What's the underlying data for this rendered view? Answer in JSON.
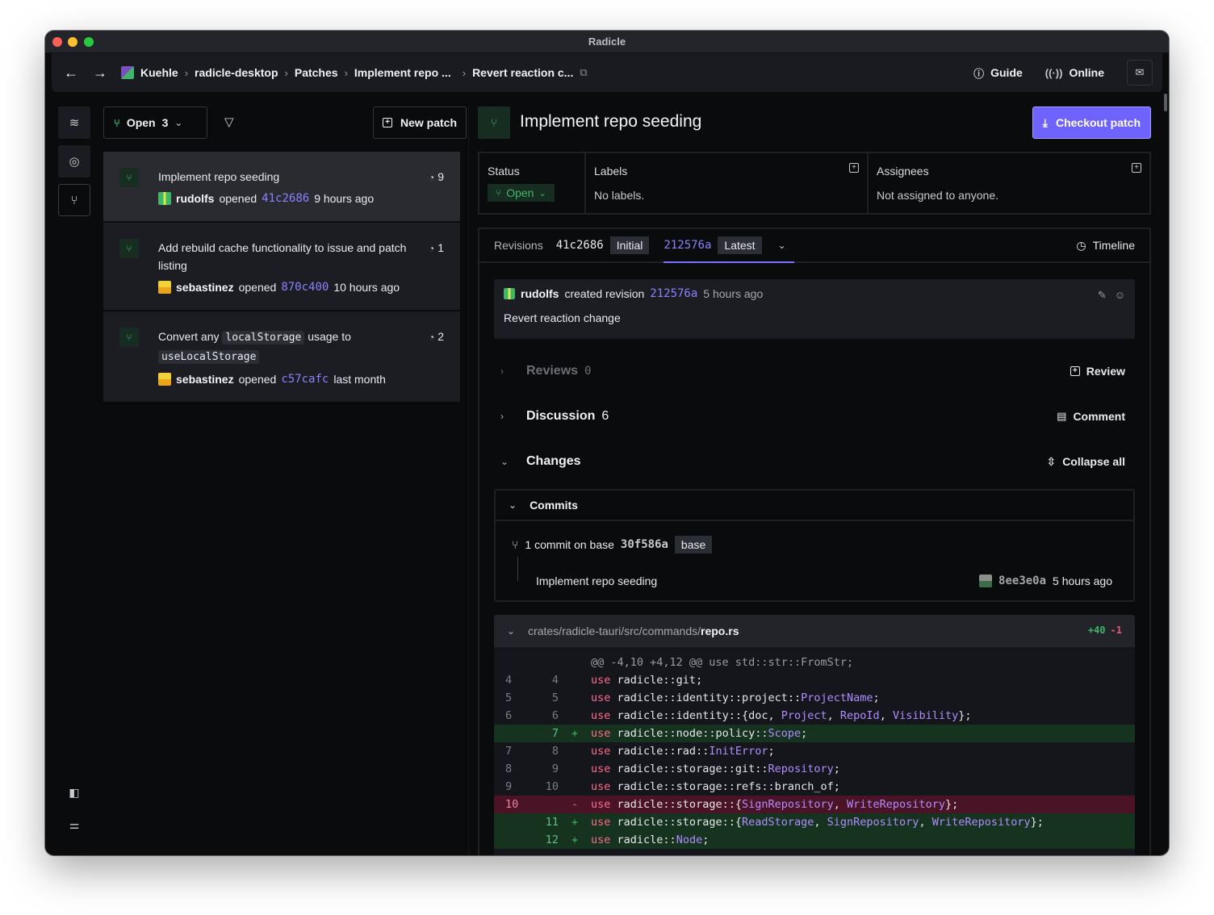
{
  "window": {
    "title": "Radicle"
  },
  "topbar": {
    "breadcrumbs": [
      "Kuehle",
      "radicle-desktop",
      "Patches",
      "Implement repo ...",
      "Revert reaction c..."
    ],
    "guide_label": "Guide",
    "online_label": "Online"
  },
  "patch_list": {
    "filter_label": "Open",
    "filter_count": "3",
    "new_patch_label": "New patch",
    "opened_word": "opened",
    "items": [
      {
        "title": "Implement repo seeding",
        "comments": "9",
        "author": "rudolfs",
        "hash": "41c2686",
        "time": "9 hours ago"
      },
      {
        "title": "Add rebuild cache functionality to issue and patch listing",
        "comments": "1",
        "author": "sebastinez",
        "hash": "870c400",
        "time": "10 hours ago"
      },
      {
        "title_pre": "Convert any",
        "title_code1": "localStorage",
        "title_mid": "usage to",
        "title_code2": "useLocalStorage",
        "comments": "2",
        "author": "sebastinez",
        "hash": "c57cafc",
        "time": "last month"
      }
    ]
  },
  "patch": {
    "title": "Implement repo seeding",
    "checkout_label": "Checkout patch",
    "status_label": "Status",
    "status_value": "Open",
    "labels_label": "Labels",
    "labels_value": "No labels.",
    "assignees_label": "Assignees",
    "assignees_value": "Not assigned to anyone."
  },
  "revisions": {
    "label": "Revisions",
    "initial_hash": "41c2686",
    "initial_tag": "Initial",
    "latest_hash": "212576a",
    "latest_tag": "Latest",
    "timeline_label": "Timeline",
    "card": {
      "author": "rudolfs",
      "action": "created revision",
      "hash": "212576a",
      "time": "5 hours ago",
      "description": "Revert reaction change"
    }
  },
  "sections": {
    "reviews": {
      "title": "Reviews",
      "count": "0",
      "action": "Review"
    },
    "discussion": {
      "title": "Discussion",
      "count": "6",
      "action": "Comment"
    },
    "changes": {
      "title": "Changes",
      "action": "Collapse all"
    }
  },
  "commits": {
    "title": "Commits",
    "base_text": "1 commit on base",
    "base_hash": "30f586a",
    "base_tag": "base",
    "item_message": "Implement repo seeding",
    "item_hash": "8ee3e0a",
    "item_time": "5 hours ago"
  },
  "diff": {
    "path_prefix": "crates/radicle-tauri/src/commands/",
    "path_file": "repo.rs",
    "additions": "+40",
    "deletions": "-1",
    "hunk": "@@ -4,10 +4,12 @@ use std::str::FromStr;",
    "lines": [
      {
        "type": "ctx",
        "old": "4",
        "new": "4",
        "sign": "",
        "code": "radicle::git;"
      },
      {
        "type": "ctx",
        "old": "5",
        "new": "5",
        "sign": "",
        "code": "radicle::identity::project::ProjectName;"
      },
      {
        "type": "ctx",
        "old": "6",
        "new": "6",
        "sign": "",
        "code": "radicle::identity::{doc, Project, RepoId, Visibility};"
      },
      {
        "type": "add",
        "old": "",
        "new": "7",
        "sign": "+",
        "code": "radicle::node::policy::Scope;"
      },
      {
        "type": "ctx",
        "old": "7",
        "new": "8",
        "sign": "",
        "code": "radicle::rad::InitError;"
      },
      {
        "type": "ctx",
        "old": "8",
        "new": "9",
        "sign": "",
        "code": "radicle::storage::git::Repository;"
      },
      {
        "type": "ctx",
        "old": "9",
        "new": "10",
        "sign": "",
        "code": "radicle::storage::refs::branch_of;"
      },
      {
        "type": "del",
        "old": "10",
        "new": "",
        "sign": "-",
        "code": "radicle::storage::{SignRepository, WriteRepository};"
      },
      {
        "type": "add",
        "old": "",
        "new": "11",
        "sign": "+",
        "code": "radicle::storage::{ReadStorage, SignRepository, WriteRepository};"
      },
      {
        "type": "add",
        "old": "",
        "new": "12",
        "sign": "+",
        "code": "radicle::Node;"
      }
    ],
    "keyword": "use"
  }
}
